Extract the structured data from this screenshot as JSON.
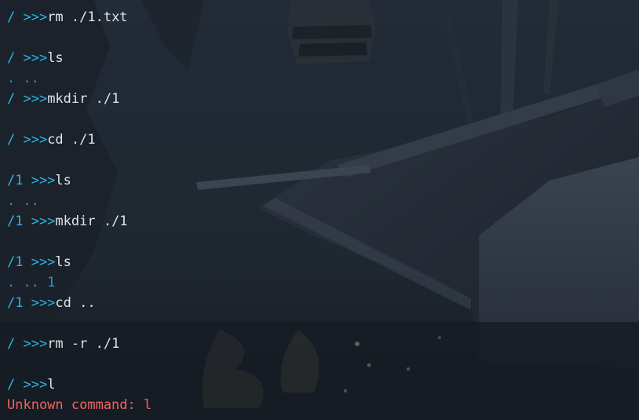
{
  "colors": {
    "prompt": "#2bb5e3",
    "command": "#dfe5ea",
    "output": "#2f8fd8",
    "error": "#f06262",
    "background": "#1e2530"
  },
  "terminal": {
    "lines": [
      {
        "prompt": "/ >>>",
        "command": "rm ./1.txt"
      },
      {
        "blank": true
      },
      {
        "prompt": "/ >>>",
        "command": "ls"
      },
      {
        "output": ". .."
      },
      {
        "prompt": "/ >>>",
        "command": "mkdir ./1"
      },
      {
        "blank": true
      },
      {
        "prompt": "/ >>>",
        "command": "cd ./1"
      },
      {
        "blank": true
      },
      {
        "prompt": "/1 >>>",
        "command": "ls"
      },
      {
        "output": ". .."
      },
      {
        "prompt": "/1 >>>",
        "command": "mkdir ./1"
      },
      {
        "blank": true
      },
      {
        "prompt": "/1 >>>",
        "command": "ls"
      },
      {
        "output": ". .. 1"
      },
      {
        "prompt": "/1 >>>",
        "command": "cd .."
      },
      {
        "blank": true
      },
      {
        "prompt": "/ >>>",
        "command": "rm -r ./1"
      },
      {
        "blank": true
      },
      {
        "prompt": "/ >>>",
        "command": "l"
      },
      {
        "error": "Unknown command: l"
      }
    ]
  }
}
